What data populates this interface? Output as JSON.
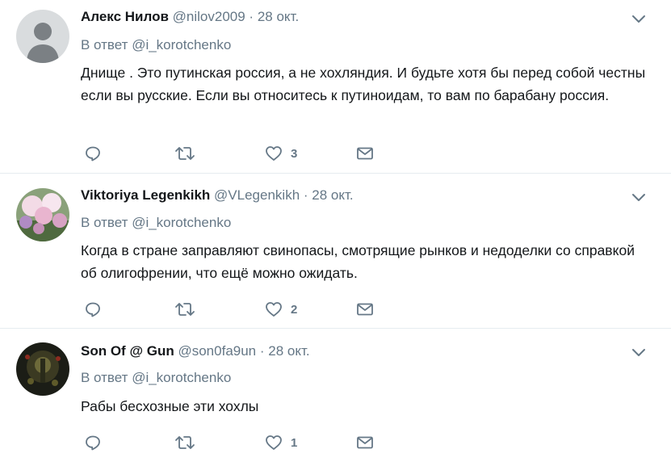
{
  "tweets": [
    {
      "name": "Алекс Нилов",
      "handle": "@nilov2009",
      "separator": "·",
      "date": "28 окт.",
      "reply_prefix": "В ответ",
      "reply_handle": "@i_korotchenko",
      "text": "Днище . Это путинская россия, а не хохляндия. И будьте хотя бы перед собой честны если вы русские. Если вы относитесь к путиноидам, то вам по барабану россия.",
      "like_count": "3"
    },
    {
      "name": "Viktoriya Legenkikh",
      "handle": "@VLegenkikh",
      "separator": "·",
      "date": "28 окт.",
      "reply_prefix": "В ответ",
      "reply_handle": "@i_korotchenko",
      "text": "Когда в стране заправляют свинопасы, смотрящие рынков и недоделки со справкой об олигофрении, что ещё можно ожидать.",
      "like_count": "2"
    },
    {
      "name": "Son Of @ Gun",
      "handle": "@son0fa9un",
      "separator": "·",
      "date": "28 окт.",
      "reply_prefix": "В ответ",
      "reply_handle": "@i_korotchenko",
      "text": "Рабы бесхозные эти хохлы",
      "like_count": "1"
    }
  ],
  "icons": {
    "reply": "reply-icon",
    "retweet": "retweet-icon",
    "like": "heart-icon",
    "dm": "envelope-icon",
    "menu": "chevron-down-icon"
  },
  "colors": {
    "text": "#14171a",
    "muted": "#657786",
    "border": "#e6ecf0"
  }
}
